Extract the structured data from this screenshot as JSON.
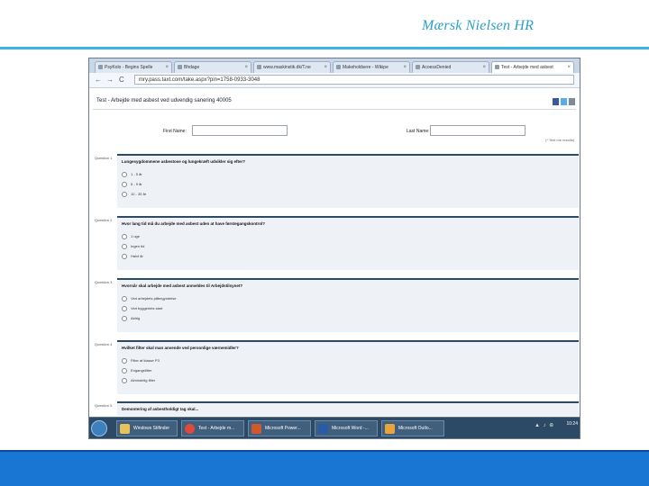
{
  "slide": {
    "title": "Mærsk Nielsen HR"
  },
  "browser": {
    "tabs": [
      "PsyKolo - Begins Spelle",
      "Bhdage",
      "www.maskinstik.dk/T.ne",
      "Makeholdsere - Wikipe",
      "AcoessDenied",
      "Test - Arbejde med asbest"
    ],
    "close_glyph": "×",
    "nav": {
      "back": "←",
      "forward": "→",
      "reload": "C"
    },
    "url": "mry.pass.taxt.com/take.aspx?pin=1758-0933-3048"
  },
  "page": {
    "title": "Test - Arbejde med asbest ved udvendig sanering 40005",
    "first_name_label": "First Name:",
    "last_name_label": "Last Name:",
    "note": "(* Test me results)",
    "questions": [
      {
        "label": "Question 1",
        "text": "Lungesygdommene asbestose og lungekræft udvikler sig efter?",
        "options": [
          "1 - 5 år",
          "5 - 9 år",
          "10 - 35 år"
        ]
      },
      {
        "label": "Question 2",
        "text": "Hvor lang tid må du arbejde med asbest uden at have førstegangskontrol?",
        "options": [
          "1 uge",
          "Ingen tid",
          "Halvt år"
        ]
      },
      {
        "label": "Question 3",
        "text": "Hvornår skal arbejde med asbest anmeldes til Arbejdstilsynet?",
        "options": [
          "Ved arbejdets påbegyndelse",
          "Ved byggeriets start",
          "Aldrig"
        ]
      },
      {
        "label": "Question 4",
        "text": "Hvilket filter skal man anvende ved personlige værnemidler?",
        "options": [
          "Filter af klasse P3",
          "Engangsfilter",
          "Almindelig filter"
        ]
      },
      {
        "label": "Question 5",
        "text": "Demontering af asbestholdigt tag skal...",
        "options": []
      }
    ]
  },
  "taskbar": {
    "items": [
      "Windows Stifinder",
      "Test - Arbejde m...",
      "Microsoft Power...",
      "Microsoft Word -...",
      "Microsoft Outlo..."
    ],
    "tray": "▲ ♪ ⊕",
    "time": "10:24"
  },
  "colors": {
    "accent": "#38b6e0",
    "title": "#2aa0c8",
    "footer": "#1976d2",
    "question_rule": "#2b4a66"
  }
}
